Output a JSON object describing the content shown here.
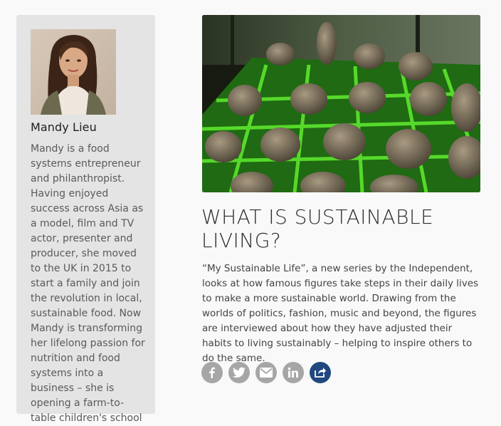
{
  "author": {
    "name": "Mandy Lieu",
    "bio": "Mandy is a food systems entrepreneur and philanthropist. Having enjoyed success across Asia as a model, film and TV actor, presenter and producer, she moved to the UK in 2015 to start a family and join the revolution in local, sustainable food. Now Mandy is transforming her lifelong passion for nutrition and food systems into a business – she is opening a farm-to-table children's school"
  },
  "article": {
    "title": "What is sustainable living?",
    "lede": "“My Sustainable Life”, a new series by the Independent, looks at how famous figures take steps in their daily lives to make a more sustainable world. Drawing from the worlds of politics, fashion, music and beyond, the figures are interviewed about how they have adjusted their habits to living sustainably – helping to inspire others to do the same."
  },
  "share": [
    {
      "icon": "facebook-icon",
      "color": "#a6a6a6"
    },
    {
      "icon": "twitter-icon",
      "color": "#a6a6a6"
    },
    {
      "icon": "email-icon",
      "color": "#a6a6a6"
    },
    {
      "icon": "linkedin-icon",
      "color": "#a6a6a6"
    },
    {
      "icon": "share-icon",
      "color": "#20487e"
    }
  ]
}
